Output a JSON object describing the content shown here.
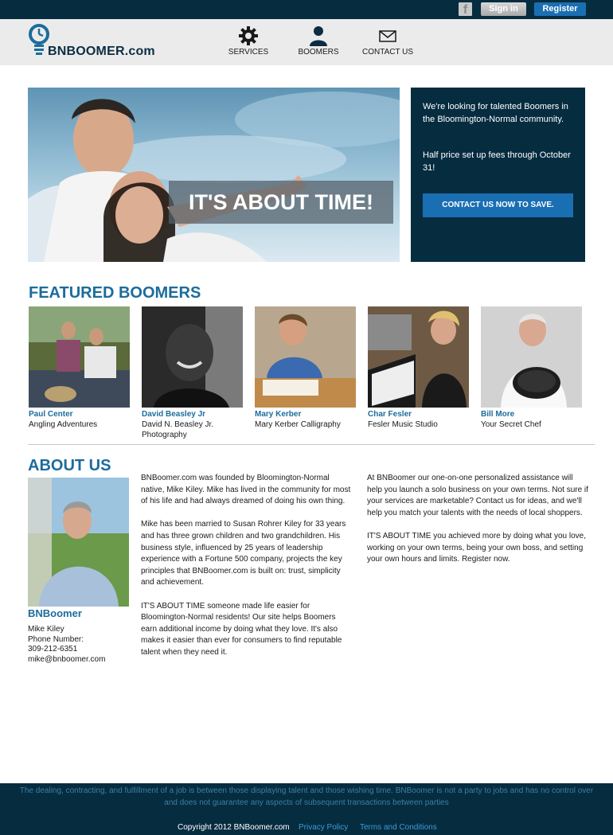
{
  "topbar": {
    "facebook_glyph": "f",
    "signin_label": "Sign in",
    "register_label": "Register"
  },
  "header": {
    "logo_text": "BNBOOMER.com",
    "nav": [
      {
        "label": "SERVICES",
        "icon": "gear-icon"
      },
      {
        "label": "BOOMERS",
        "icon": "person-icon"
      },
      {
        "label": "CONTACT US",
        "icon": "envelope-icon"
      }
    ]
  },
  "hero": {
    "banner_text": "IT'S ABOUT TIME!"
  },
  "promo": {
    "text1": "We're looking for talented Boomers in the Bloomington-Normal community.",
    "text2": "Half price set up fees through October 31!",
    "button_label": "CONTACT US NOW TO SAVE."
  },
  "featured": {
    "title": "FEATURED BOOMERS",
    "boomers": [
      {
        "name": "Paul Center",
        "business": "Angling Adventures"
      },
      {
        "name": "David Beasley Jr",
        "business": "David N. Beasley Jr. Photography"
      },
      {
        "name": "Mary Kerber",
        "business": "Mary Kerber Calligraphy"
      },
      {
        "name": "Char Fesler",
        "business": "Fesler Music Studio"
      },
      {
        "name": "Bill More",
        "business": "Your Secret Chef"
      }
    ]
  },
  "about": {
    "title": "ABOUT US",
    "company_name": "BNBoomer",
    "contact": {
      "name": "Mike Kiley",
      "phone_label": "Phone Number:",
      "phone": "309-212-6351",
      "email": "mike@bnboomer.com"
    },
    "col1": [
      "BNBoomer.com was founded by Bloomington-Normal native, Mike Kiley. Mike has lived in the community for most of his life and had always dreamed of doing his own thing.",
      "Mike has been married to Susan Rohrer Kiley for 33 years and has three grown children and two grandchildren. His business style, influenced by 25 years of leadership experience with a Fortune 500 company, projects the key principles that BNBoomer.com is built on: trust, simplicity and achievement.",
      "IT'S ABOUT TIME someone made life easier for Bloomington-Normal residents! Our site helps Boomers earn additional income by doing what they love. It's also makes it easier than ever for consumers to find reputable talent when they need it."
    ],
    "col2": [
      "At BNBoomer our one-on-one personalized assistance will help you launch a solo business on your own terms. Not sure if your services are marketable? Contact us for ideas, and we'll help you match your talents with the needs of local shoppers.",
      "IT'S ABOUT TIME you achieved more by doing what you love, working on your own terms, being your own boss, and setting your own hours and limits. Register now."
    ]
  },
  "footer": {
    "disclaimer": "The dealing, contracting, and fulfillment of a job is between those displaying talent and those wishing time. BNBoomer is not a party to jobs and has no control over and does not guarantee any aspects of subsequent transactions between parties",
    "copyright": "Copyright 2012 BNBoomer.com",
    "privacy_label": "Privacy Policy",
    "terms_label": "Terms and Conditions"
  },
  "colors": {
    "navy": "#062c40",
    "accent_blue": "#1a6fb3",
    "heading_blue": "#1c6c9c",
    "header_gray": "#ebebeb"
  }
}
